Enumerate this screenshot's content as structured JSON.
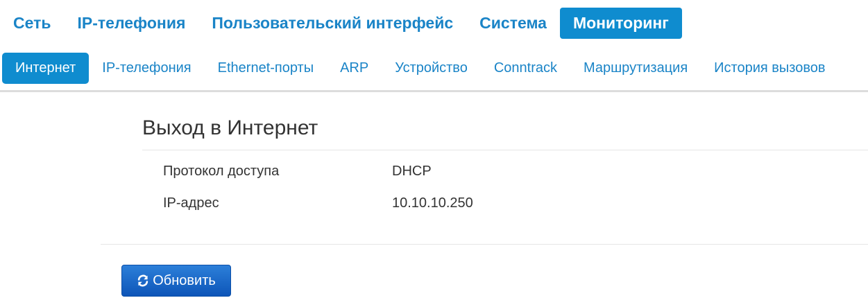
{
  "top_nav": {
    "tabs": [
      {
        "label": "Сеть",
        "active": false
      },
      {
        "label": "IP-телефония",
        "active": false
      },
      {
        "label": "Пользовательский интерфейс",
        "active": false
      },
      {
        "label": "Система",
        "active": false
      },
      {
        "label": "Мониторинг",
        "active": true
      }
    ]
  },
  "sub_nav": {
    "tabs": [
      {
        "label": "Интернет",
        "active": true
      },
      {
        "label": "IP-телефония",
        "active": false
      },
      {
        "label": "Ethernet-порты",
        "active": false
      },
      {
        "label": "ARP",
        "active": false
      },
      {
        "label": "Устройство",
        "active": false
      },
      {
        "label": "Conntrack",
        "active": false
      },
      {
        "label": "Маршрутизация",
        "active": false
      },
      {
        "label": "История вызовов",
        "active": false
      }
    ]
  },
  "section": {
    "title": "Выход в Интернет",
    "rows": [
      {
        "label": "Протокол доступа",
        "value": "DHCP"
      },
      {
        "label": "IP-адрес",
        "value": "10.10.10.250"
      }
    ]
  },
  "actions": {
    "refresh_label": "Обновить",
    "refresh_icon": "refresh-icon"
  },
  "colors": {
    "accent": "#0f8ccf",
    "link": "#1a84c7",
    "button": "#1a6ac8"
  }
}
